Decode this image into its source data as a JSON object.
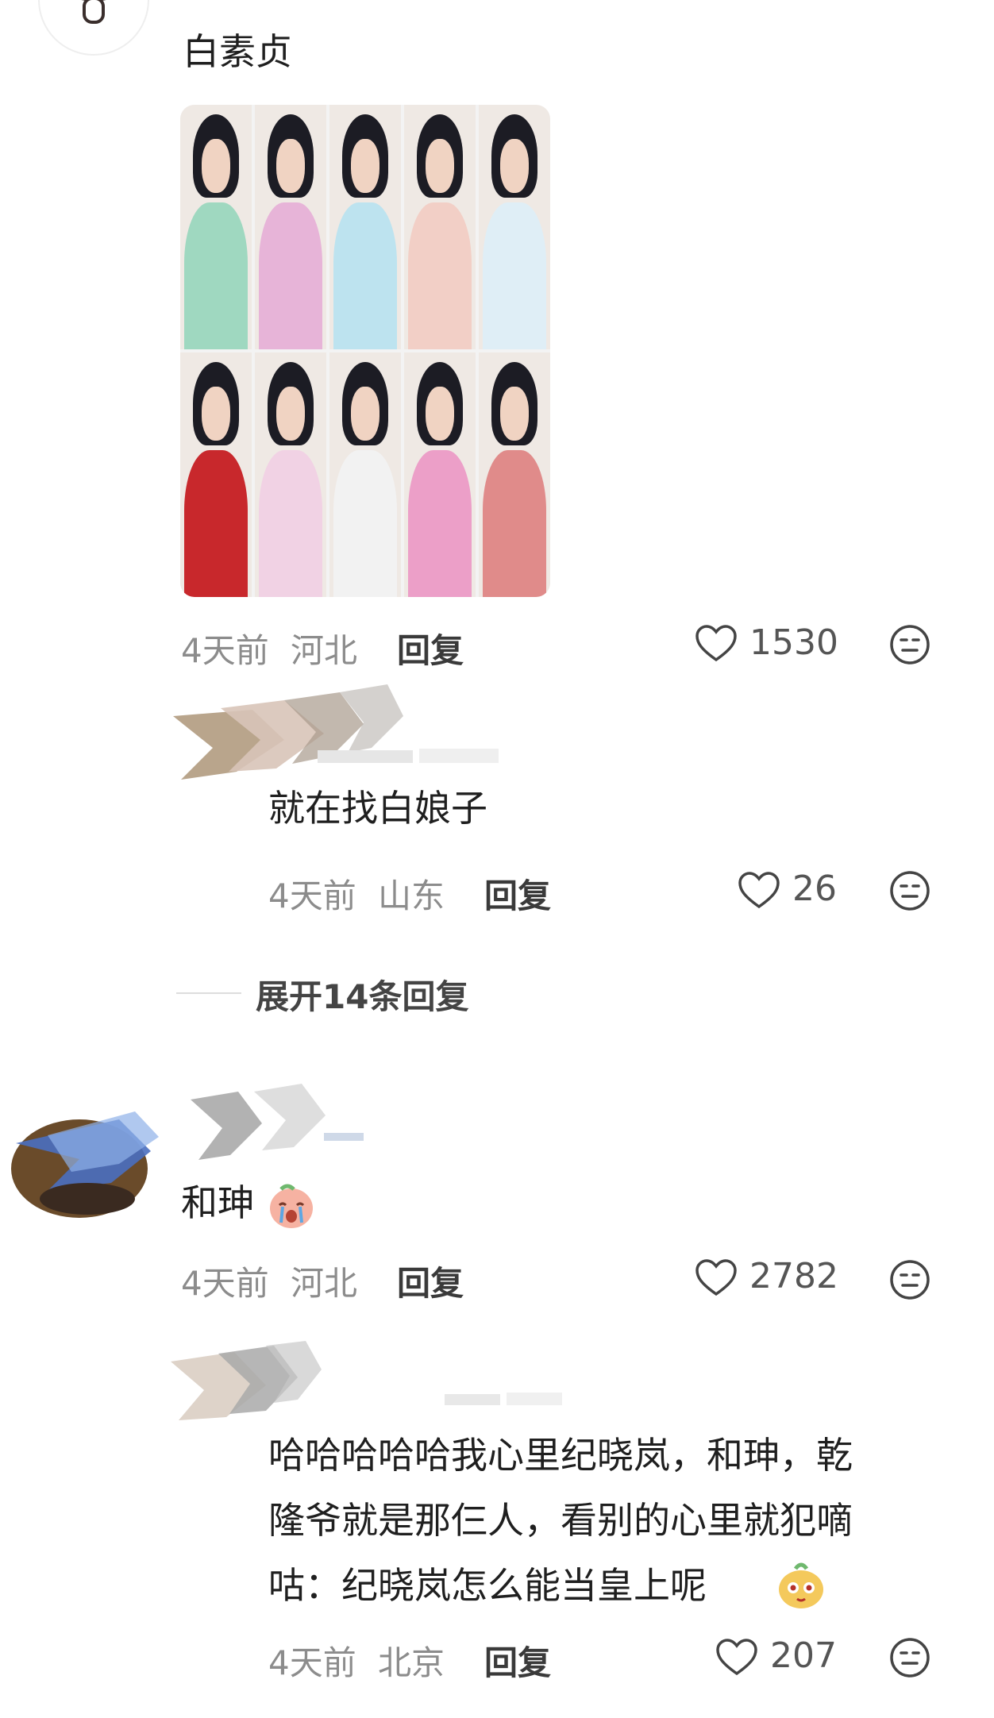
{
  "comments": [
    {
      "text": "白素贞",
      "time": "4天前",
      "location": "河北",
      "reply_label": "回复",
      "likes": "1530",
      "replies": [
        {
          "text": "就在找白娘子",
          "time": "4天前",
          "location": "山东",
          "reply_label": "回复",
          "likes": "26"
        }
      ],
      "expand_label": "展开14条回复"
    },
    {
      "text": "和珅",
      "time": "4天前",
      "location": "河北",
      "reply_label": "回复",
      "likes": "2782",
      "replies": [
        {
          "text_lines": [
            "哈哈哈哈哈我心里纪晓岚，和珅，乾",
            "隆爷就是那仨人，看别的心里就犯嘀",
            "咕：纪晓岚怎么能当皇上呢"
          ],
          "time": "4天前",
          "location": "北京",
          "reply_label": "回复",
          "likes": "207"
        }
      ]
    }
  ],
  "icons": {
    "like": "heart-outline-icon",
    "dislike": "neutral-face-icon",
    "avatar_top": "mushroom-icon",
    "emoji_1": "crying-face-emoji",
    "emoji_2": "potato-face-emoji"
  },
  "colors": {
    "text": "#1f1f1f",
    "meta": "#8c8c8c",
    "divider": "#dddddd"
  },
  "collage": {
    "robe_colors": [
      "#9fd8c0",
      "#e7b4d8",
      "#bde3ef",
      "#f2cfc6",
      "#dfeef6",
      "#c8282c",
      "#f1d2e4",
      "#f2f2f2",
      "#ec9fc8",
      "#e08b8a"
    ]
  }
}
